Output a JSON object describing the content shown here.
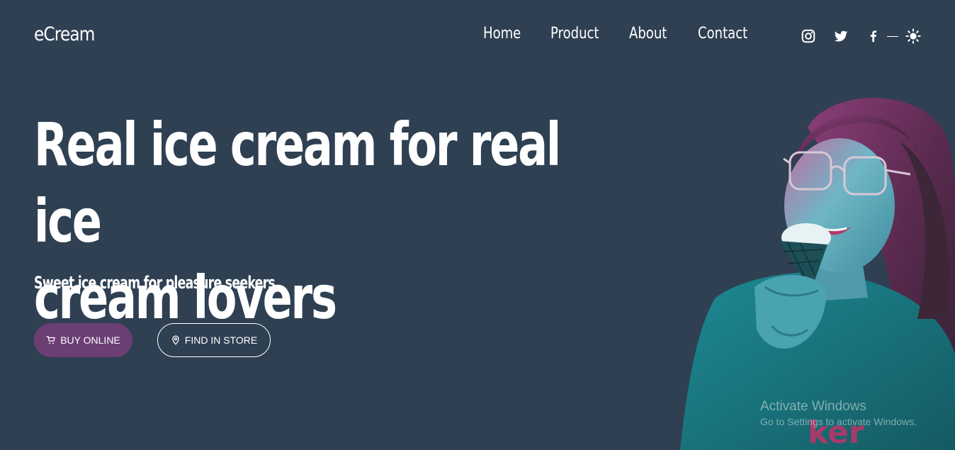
{
  "brand": {
    "logo": "eCream"
  },
  "nav": {
    "items": [
      {
        "label": "Home"
      },
      {
        "label": "Product"
      },
      {
        "label": "About"
      },
      {
        "label": "Contact"
      }
    ]
  },
  "social": {
    "icons": [
      "instagram-icon",
      "twitter-icon",
      "facebook-icon",
      "theme-toggle-sun-icon"
    ]
  },
  "hero": {
    "headline_line1": "Real ice cream for real ice",
    "headline_line2": "cream lovers",
    "subheadline": "Sweet ice cream for pleasure seekers.",
    "buy_button": "BUY ONLINE",
    "store_button": "FIND IN STORE"
  },
  "watermark": {
    "title": "Activate Windows",
    "subtitle": "Go to Settings to activate Windows."
  },
  "colors": {
    "background": "#2e4052",
    "buy_button": "#6b3e74",
    "text": "#ffffff"
  }
}
